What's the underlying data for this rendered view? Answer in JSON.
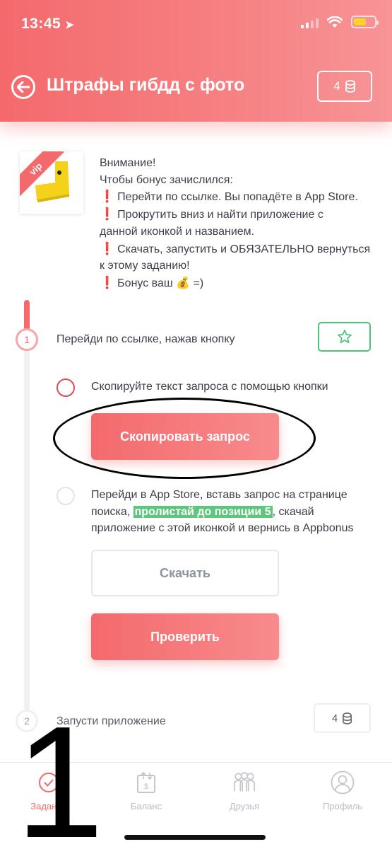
{
  "status": {
    "time": "13:45",
    "arrow": "➤"
  },
  "header": {
    "title": "Штрафы гибдд с фото",
    "coins": "4"
  },
  "intro": {
    "badge": "vip",
    "lines": [
      "Внимание!",
      "Чтобы бонус зачислился:",
      "Перейти по ссылке. Вы попадёте в  App Store.",
      "Прокрутить вниз и найти приложение с",
      "данной иконкой и названием.",
      "Скачать, запустить и ОБЯЗАТЕЛЬНО вернуться",
      "к этому заданию!",
      "Бонус ваш",
      "=)"
    ],
    "excl": "❗",
    "money_emoji": "💰"
  },
  "step1": {
    "number": "1",
    "title": "Перейди по ссылке, нажав кнопку",
    "copy_text": "Скопируйте текст запроса с помощью кнопки",
    "copy_button": "Скопировать запрос",
    "store_text_1a": "Перейди в App Store, вставь запрос на странице",
    "store_text_2a": "поиска, ",
    "store_text_2b": "пролистай до позиции 5",
    "store_text_2c": ", скачай",
    "store_text_3": "приложение с этой иконкой и вернись в Appbonus",
    "download_button": "Скачать",
    "check_button": "Проверить"
  },
  "step2": {
    "number": "2",
    "title": "Запусти приложение",
    "coins": "4"
  },
  "tabs": [
    {
      "label": "Задания"
    },
    {
      "label": "Баланс"
    },
    {
      "label": "Друзья"
    },
    {
      "label": "Профиль"
    }
  ],
  "overlay_number": "1",
  "colors": {
    "accent": "#f46a6c",
    "green": "#4cc27a",
    "highlight": "#5cc77d"
  }
}
